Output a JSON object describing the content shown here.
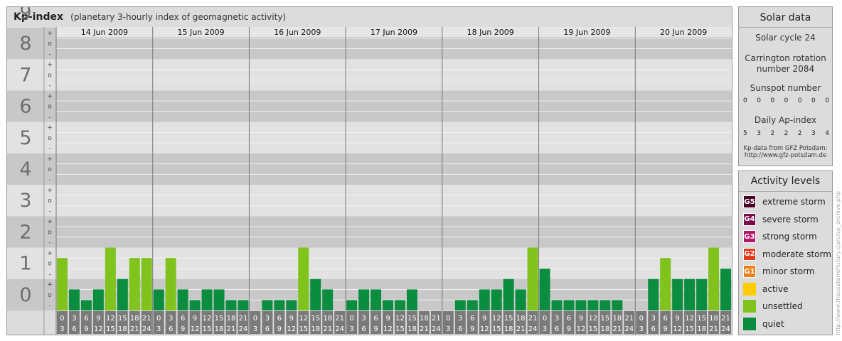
{
  "header": {
    "title": "Kp-index",
    "subtitle": "(planetary 3-hourly index of geomagnetic activity)"
  },
  "solar": {
    "title": "Solar data",
    "cycle": "Solar cycle 24",
    "carrington_line1": "Carrington rotation",
    "carrington_line2": "number 2084",
    "sunspot_label": "Sunspot number",
    "sunspot_values": [
      "0",
      "0",
      "0",
      "0",
      "0",
      "0",
      "0"
    ],
    "ap_label": "Daily Ap-index",
    "ap_values": [
      "5",
      "3",
      "2",
      "2",
      "2",
      "3",
      "4"
    ],
    "source_line1": "Kp-data from GFZ Potsdam:",
    "source_line2": "http://www.gfz-potsdam.de"
  },
  "activity": {
    "title": "Activity levels",
    "levels": [
      {
        "badge": "G5",
        "label": "extreme storm",
        "color": "#4a0026"
      },
      {
        "badge": "G4",
        "label": "severe storm",
        "color": "#7a0a4a"
      },
      {
        "badge": "G3",
        "label": "strong storm",
        "color": "#b5156a"
      },
      {
        "badge": "G2",
        "label": "moderate storm",
        "color": "#e03c1a"
      },
      {
        "badge": "G1",
        "label": "minor storm",
        "color": "#ee7f1a"
      },
      {
        "badge": "",
        "label": "active",
        "color": "#ffcc00"
      },
      {
        "badge": "",
        "label": "unsettled",
        "color": "#7fc31c"
      },
      {
        "badge": "",
        "label": "quiet",
        "color": "#0a8d3e"
      }
    ]
  },
  "watermark": "http://www.theusaterreflutury.cjarc/ap_archive.php",
  "chart_data": {
    "type": "bar",
    "title": "Kp-index",
    "subtitle": "(planetary 3-hourly index of geomagnetic activity)",
    "ylim": [
      0,
      9
    ],
    "y_ticks": [
      "0",
      "1",
      "2",
      "3",
      "4",
      "5",
      "6",
      "7",
      "8",
      "9"
    ],
    "sub_ticks": [
      "-",
      "o",
      "+"
    ],
    "days": [
      "14 Jun 2009",
      "15 Jun 2009",
      "16 Jun 2009",
      "17 Jun 2009",
      "18 Jun 2009",
      "19 Jun 2009",
      "20 Jun 2009"
    ],
    "hour_labels": [
      [
        "0",
        "3"
      ],
      [
        "3",
        "6"
      ],
      [
        "6",
        "9"
      ],
      [
        "9",
        "12"
      ],
      [
        "12",
        "15"
      ],
      [
        "15",
        "18"
      ],
      [
        "18",
        "21"
      ],
      [
        "21",
        "24"
      ]
    ],
    "colors": {
      "quiet": "#0a8d3e",
      "unsettled": "#7fc31c"
    },
    "series": [
      {
        "values": [
          1.67,
          0.67,
          0.33,
          0.67,
          2.0,
          1.0,
          1.67,
          1.67,
          0.67,
          1.67,
          0.67,
          0.33,
          0.67,
          0.67,
          0.33,
          0.33,
          0.0,
          0.33,
          0.33,
          0.33,
          2.0,
          1.0,
          0.67,
          0.0,
          0.33,
          0.67,
          0.67,
          0.33,
          0.33,
          0.67,
          0.0,
          0.0,
          0.0,
          0.33,
          0.33,
          0.67,
          0.67,
          1.0,
          0.67,
          2.0,
          1.33,
          0.33,
          0.33,
          0.33,
          0.33,
          0.33,
          0.33,
          0.0,
          0.0,
          1.0,
          1.67,
          1.0,
          1.0,
          1.0,
          2.0,
          1.33
        ]
      }
    ]
  }
}
